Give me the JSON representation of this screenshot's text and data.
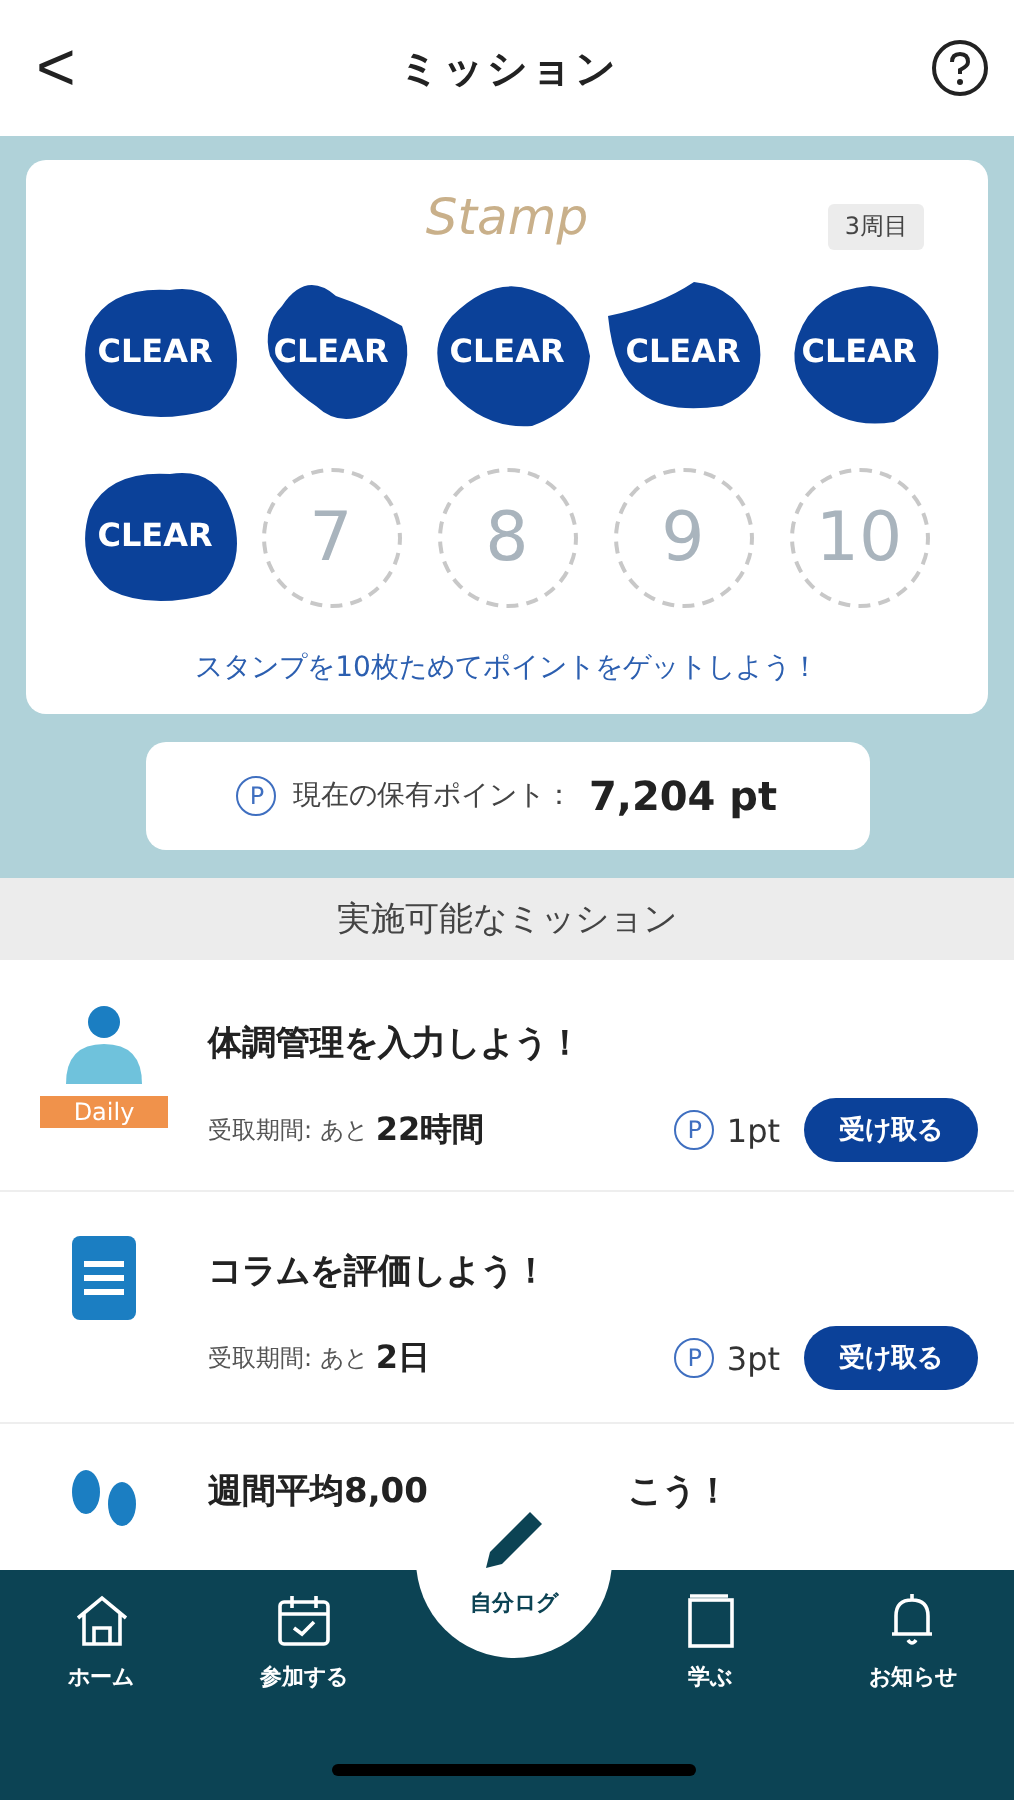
{
  "header": {
    "back": "<",
    "title": "ミッション"
  },
  "stamp_card": {
    "title": "Stamp",
    "round_badge": "3周目",
    "caption": "スタンプを10枚ためてポイントをゲットしよう！",
    "stamps": [
      {
        "kind": "clear",
        "label": "CLEAR"
      },
      {
        "kind": "clear",
        "label": "CLEAR"
      },
      {
        "kind": "clear",
        "label": "CLEAR"
      },
      {
        "kind": "clear",
        "label": "CLEAR"
      },
      {
        "kind": "clear",
        "label": "CLEAR"
      },
      {
        "kind": "clear",
        "label": "CLEAR"
      },
      {
        "kind": "empty",
        "label": "7"
      },
      {
        "kind": "empty",
        "label": "8"
      },
      {
        "kind": "empty",
        "label": "9"
      },
      {
        "kind": "empty",
        "label": "10"
      }
    ]
  },
  "points": {
    "icon": "P",
    "label": "現在の保有ポイント：",
    "value": "7,204 pt"
  },
  "section_title": "実施可能なミッション",
  "missions": [
    {
      "kind": "person",
      "badge": "Daily",
      "title": "体調管理を入力しよう！",
      "period_label": "受取期間: あと",
      "period_value": "22時間",
      "point_icon": "P",
      "points": "1pt",
      "button": "受け取る"
    },
    {
      "kind": "column",
      "title": "コラムを評価しよう！",
      "period_label": "受取期間: あと",
      "period_value": "2日",
      "point_icon": "P",
      "points": "3pt",
      "button": "受け取る"
    },
    {
      "kind": "steps",
      "title_parts": [
        "週間平均8,00",
        "こう！"
      ]
    }
  ],
  "nav": {
    "items": [
      {
        "kind": "home",
        "label": "ホーム"
      },
      {
        "kind": "calendar",
        "label": "参加する"
      },
      {
        "kind": "center",
        "label": "自分ログ"
      },
      {
        "kind": "book",
        "label": "学ぶ"
      },
      {
        "kind": "bell",
        "label": "お知らせ"
      }
    ]
  }
}
